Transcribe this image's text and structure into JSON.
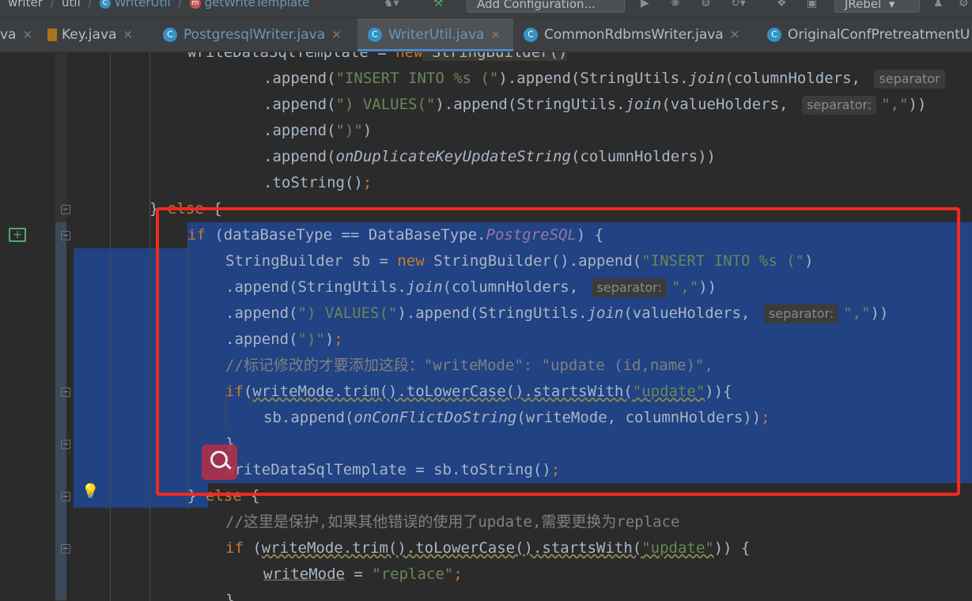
{
  "breadcrumb": {
    "items": [
      "writer",
      "util",
      "WriterUtil",
      "getWriteTemplate"
    ]
  },
  "toolbar": {
    "add_configuration_label": "Add Configuration...",
    "jrebel_label": "JRebel"
  },
  "tabs": [
    {
      "label": "va"
    },
    {
      "label": "Key.java"
    },
    {
      "label": "PostgresqlWriter.java"
    },
    {
      "label": "WriterUtil.java"
    },
    {
      "label": "CommonRdbmsWriter.java"
    },
    {
      "label": "OriginalConfPretreatmentU"
    }
  ],
  "code": {
    "l0_a": "writeDataSqlTemplate = ",
    "l0_new": "new",
    "l0_b": " StringBuilder()",
    "l1_a": ".append(",
    "l1_str": "\"INSERT INTO %s (\"",
    "l1_b": ").append(StringUtils.",
    "l1_join": "join",
    "l1_c": "(columnHolders, ",
    "l1_hint": "separator",
    "l2_a": ".append(",
    "l2_str": "\") VALUES(\"",
    "l2_b": ").append(StringUtils.",
    "l2_join": "join",
    "l2_c": "(valueHolders, ",
    "l2_hint": "separator:",
    "l2_str2": "\",\"",
    "l2_d": "))",
    "l3_a": ".append(",
    "l3_str": "\")\"",
    "l3_b": ")",
    "l4_a": ".append(",
    "l4_fn": "onDuplicateKeyUpdateString",
    "l4_b": "(columnHolders))",
    "l5_a": ".toString()",
    "l5_semi": ";",
    "l6_a": "} ",
    "l6_kw": "else",
    "l6_b": " {",
    "l7_kw": "if",
    "l7_a": " (dataBaseType == DataBaseType.",
    "l7_field": "PostgreSQL",
    "l7_b": ") {",
    "l8_a": "StringBuilder sb = ",
    "l8_new": "new",
    "l8_b": " StringBuilder().append(",
    "l8_str": "\"INSERT INTO %s (\"",
    "l8_c": ")",
    "l9_a": ".append(StringUtils.",
    "l9_join": "join",
    "l9_b": "(columnHolders, ",
    "l9_hint": "separator:",
    "l9_str": "\",\"",
    "l9_c": "))",
    "l10_a": ".append(",
    "l10_str": "\") VALUES(\"",
    "l10_b": ").append(StringUtils.",
    "l10_join": "join",
    "l10_c": "(valueHolders, ",
    "l10_hint": "separator:",
    "l10_str2": "\",\"",
    "l10_d": "))",
    "l11_a": ".append(",
    "l11_str": "\")\"",
    "l11_b": ")",
    "l11_semi": ";",
    "l12_cmt": "//标记修改的才要添加这段：\"writeMode\": \"update (id,name)\",",
    "l13_kw": "if",
    "l13_a": "(",
    "l13_ul": "writeMode.trim().toLowerCase().startsWith(",
    "l13_str": "\"update\"",
    "l13_b": ")){",
    "l14_a": "sb.append(",
    "l14_fn": "onConFlictDoString",
    "l14_b": "(writeMode, columnHolders))",
    "l14_semi": ";",
    "l15_a": "}",
    "l16_a": "writeDataSqlTemplate = sb.toString()",
    "l16_semi": ";",
    "l17_a": "} ",
    "l17_kw": "else",
    "l17_b": " {",
    "l18_cmt": "//这里是保护,如果其他错误的使用了update,需要更换为replace",
    "l19_kw": "if",
    "l19_a": " (",
    "l19_ul": "writeMode.trim().toLowerCase().startsWith(",
    "l19_str": "\"update\"",
    "l19_b": ")) {",
    "l20_ul": "writeMode",
    "l20_a": " = ",
    "l20_str": "\"replace\"",
    "l20_semi": ";",
    "l21_a": "}"
  },
  "colors": {
    "selection": "#214283",
    "highlight_box": "#f02a21",
    "keyword": "#cc7832",
    "string": "#6a8759",
    "field": "#9876aa"
  },
  "icons": [
    "comment-icon",
    "bulb-icon",
    "search-icon",
    "class-icon",
    "method-icon"
  ]
}
